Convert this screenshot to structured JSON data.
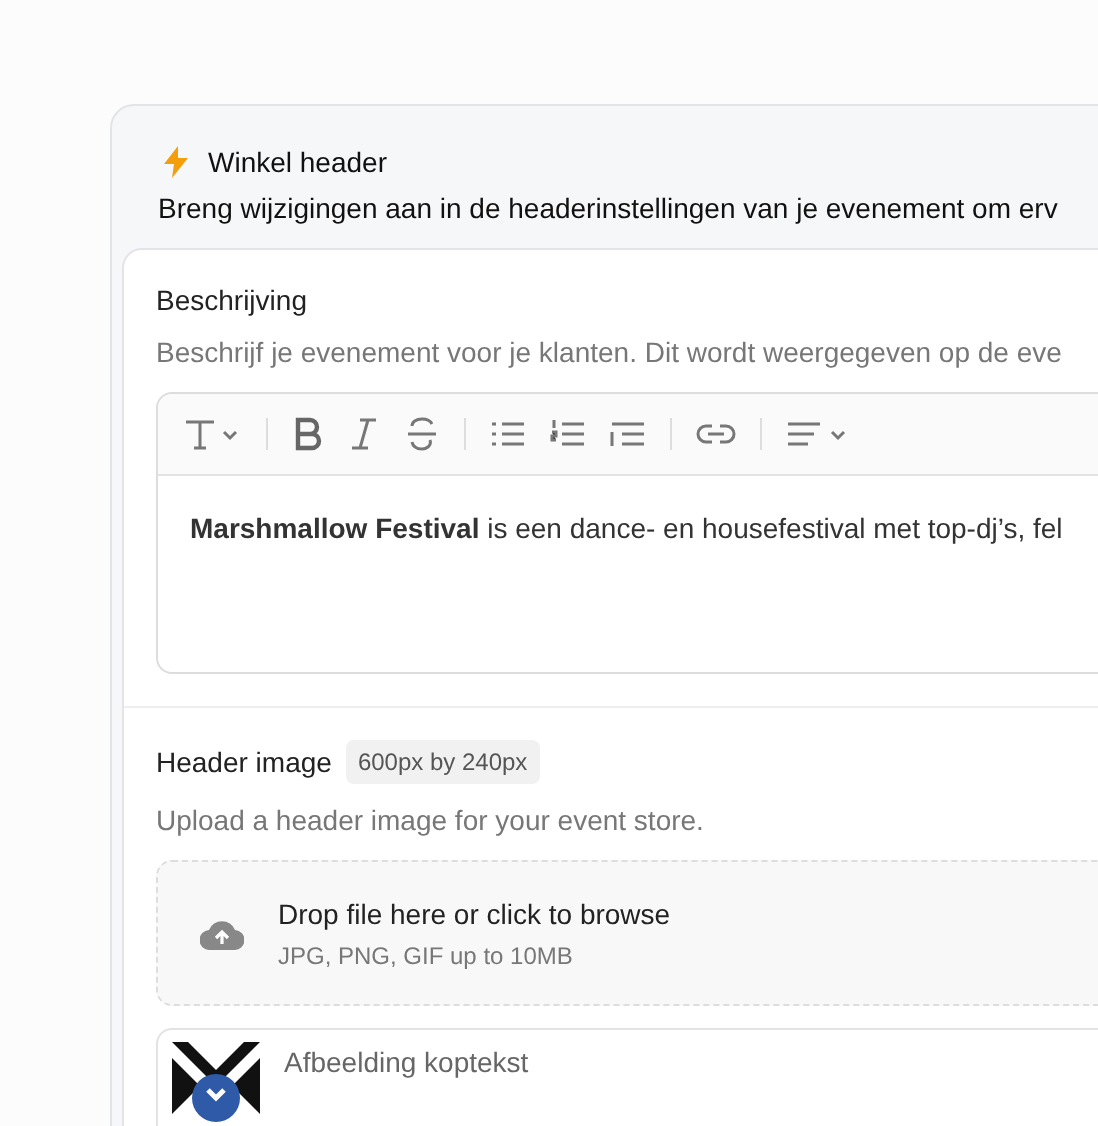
{
  "panel": {
    "title": "Winkel header",
    "description": "Breng wijzigingen aan in de headerinstellingen van je evenement om erv"
  },
  "description_section": {
    "label": "Beschrijving",
    "help": "Beschrijf je evenement voor je klanten. Dit wordt weergegeven op de eve",
    "editor_text": "**Marshmallow Festival** is een dance- en housefestival met top-dj’s, fel"
  },
  "image_section": {
    "label": "Header image",
    "badge": "600px by 240px",
    "help": "Upload a header image for your event store.",
    "dropzone": {
      "title": "Drop file here or click to browse",
      "hint": "JPG, PNG, GIF up to 10MB"
    },
    "files": [
      {
        "kind": "picture",
        "name": "Afbeelding koptekst"
      }
    ]
  }
}
